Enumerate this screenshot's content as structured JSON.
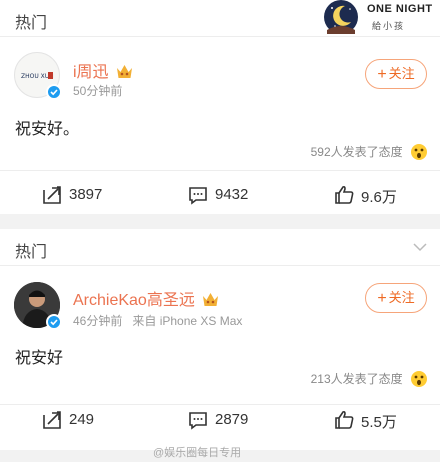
{
  "posts": [
    {
      "section_title": "热门",
      "banner": {
        "line1": "ONE NIGHT",
        "line2": "給小孩"
      },
      "user": {
        "name": "i周迅",
        "avatar_text": "ZHOU XUN"
      },
      "meta": {
        "time": "50分钟前",
        "source": ""
      },
      "follow_label": "关注",
      "text": "祝安好。",
      "reactions_text": "592人发表了态度",
      "actions": {
        "repost": "3897",
        "comment": "9432",
        "like": "9.6万"
      }
    },
    {
      "section_title": "热门",
      "user": {
        "name": "ArchieKao高圣远"
      },
      "meta": {
        "time": "46分钟前",
        "source": "来自 iPhone XS Max"
      },
      "follow_label": "关注",
      "text": "祝安好",
      "reactions_text": "213人发表了态度",
      "actions": {
        "repost": "249",
        "comment": "2879",
        "like": "5.5万"
      }
    }
  ],
  "watermark": "@娱乐圈每日专用",
  "colors": {
    "username": "#eb7350",
    "follow": "#ee6a24",
    "verified": "#1e9cf0"
  },
  "icons": [
    "moon-banner-icon",
    "chevron-down-icon",
    "verified-badge-icon",
    "vip-crown-icon",
    "shocked-emoji-icon",
    "repost-icon",
    "comment-icon",
    "like-icon"
  ]
}
